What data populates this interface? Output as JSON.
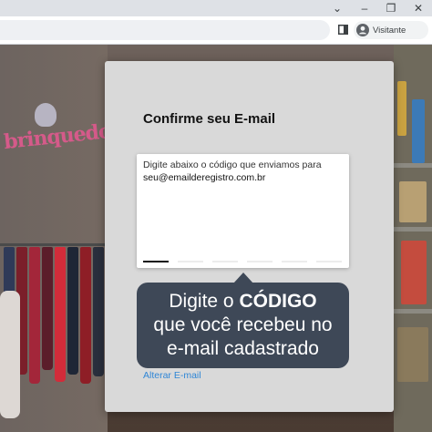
{
  "browser": {
    "window_buttons": [
      "⌄",
      "–",
      "❐",
      "✕"
    ],
    "profile_label": "Visitante"
  },
  "modal": {
    "title": "Confirme seu E-mail",
    "instruction": "Digite abaixo o código que enviamos para",
    "email": "seu@emailderegistro.com.br",
    "digit_count": 6,
    "active_digit": 1,
    "change_email_link": "Alterar E-mail"
  },
  "callout": {
    "line1_prefix": "Digite o ",
    "line1_bold": "CÓDIGO",
    "line2": "que você recebeu no",
    "line3": "e-mail cadastrado"
  },
  "colors": {
    "callout_bg": "#3e4857",
    "link": "#2f86d6",
    "modal_bg": "#d9d9d9"
  },
  "icons": [
    "chevron-down-icon",
    "minimize-icon",
    "restore-icon",
    "close-icon",
    "side-panel-icon",
    "avatar-icon"
  ]
}
